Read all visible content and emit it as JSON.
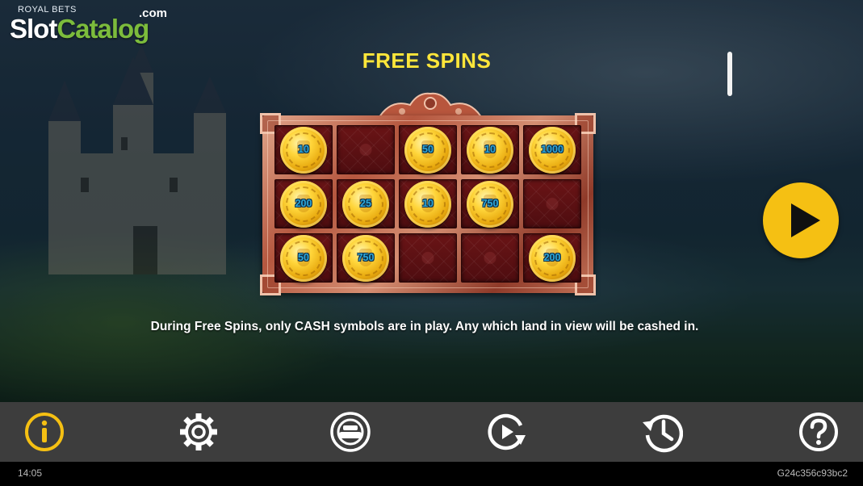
{
  "logo": {
    "brand": "ROYAL BETS",
    "word_slot": "Slot",
    "word_catalog": "Catalog",
    "domain": ".com"
  },
  "title": "FREE SPINS",
  "grid": {
    "rows": [
      [
        "10",
        "",
        "50",
        "10",
        "1000"
      ],
      [
        "200",
        "25",
        "10",
        "750",
        ""
      ],
      [
        "50",
        "750",
        "",
        "",
        "200"
      ]
    ]
  },
  "description": "During Free Spins, only CASH symbols are in play. Any which land in view will be cashed in.",
  "toolbar": {
    "icons": [
      "info-icon",
      "settings-gear-icon",
      "sound-icon",
      "autoplay-icon",
      "history-icon",
      "help-icon"
    ],
    "active_color": "#f5c013",
    "icon_color": "#ffffff"
  },
  "play_button": {
    "icon": "play-icon",
    "color": "#f5c013"
  },
  "status": {
    "time": "14:05",
    "game_id": "G24c356c93bc2"
  },
  "colors": {
    "title": "#ffe63a",
    "coin_value": "#2ea7d8",
    "cell": "#5c1013"
  }
}
